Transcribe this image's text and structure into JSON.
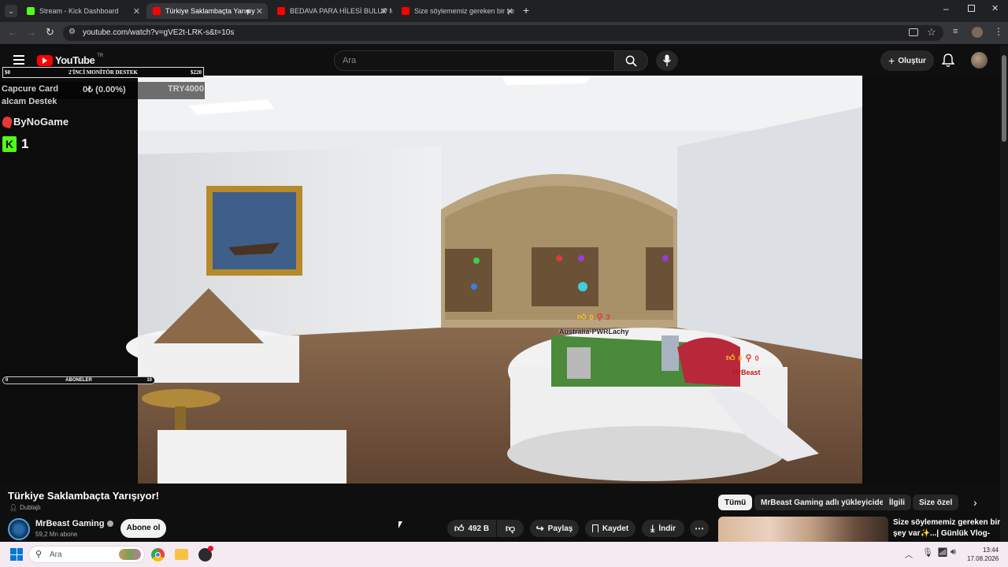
{
  "browser": {
    "tabs": [
      {
        "title": "Stream - Kick Dashboard",
        "active": false,
        "favicon_color": "#53fc18"
      },
      {
        "title": "Türkiye Saklambaçta Yarışıy",
        "active": true,
        "favicon_color": "#ff0000"
      },
      {
        "title": "BEDAVA PARA HİLESİ BULUP M",
        "active": false,
        "favicon_color": "#ff0000"
      },
      {
        "title": "Size söylememiz gereken bir şe",
        "active": false,
        "favicon_color": "#ff0000"
      }
    ],
    "url": "youtube.com/watch?v=gVE2t-LRK-s&t=10s"
  },
  "youtube": {
    "logo_text": "YouTube",
    "region": "TR",
    "search_placeholder": "Ara",
    "create_label": "Oluştur"
  },
  "overlay": {
    "goal_start": "$0",
    "goal_title": "2'İNCİ MONİTÖR DESTEK",
    "goal_end": "$220",
    "capcure_label": "Capcure Card",
    "capcure_progress": "0₺ (0.00%)",
    "capcure_target": "TRY4000",
    "alcam_label": "alcam Destek",
    "brand": "ByNoGame",
    "kick_count": "1",
    "subs_start": "0",
    "subs_label": "ABONELER",
    "subs_end": "10",
    "player1_name": "Australia-PWRLachy",
    "player1_likes": "0",
    "player1_finds": "3",
    "player2_name": "MrBeast",
    "player2_likes": "0",
    "player2_finds": "0"
  },
  "video": {
    "title": "Türkiye Saklambaçta Yarışıyor!",
    "dub_label": "Dublajlı",
    "channel": "MrBeast Gaming",
    "subscribers": "59,2 Mn abone",
    "subscribe_label": "Abone ol",
    "likes": "492 B",
    "share_label": "Paylaş",
    "save_label": "Kaydet",
    "download_label": "İndir"
  },
  "chips": [
    "Tümü",
    "MrBeast Gaming adlı yükleyiciden",
    "İlgili",
    "Size özel"
  ],
  "recommendation": {
    "title_line1": "Size söylememiz gereken bir",
    "title_line2": "şey var✨...| Günlük Vlog-"
  },
  "taskbar": {
    "search_placeholder": "Ara",
    "time": "13:44",
    "date": "17.08.2026"
  },
  "colors": {
    "kick_green": "#53fc18",
    "youtube_red": "#ff0000",
    "accent_yellow": "#f5c518"
  }
}
